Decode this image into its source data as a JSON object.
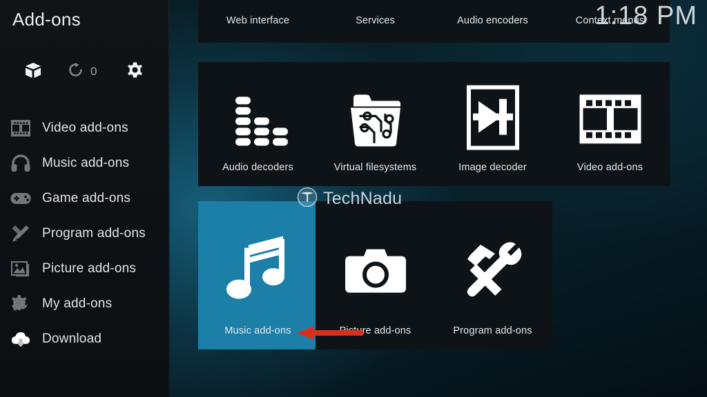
{
  "window": {
    "title": "Add-ons",
    "clock": "1:18 PM"
  },
  "header": {
    "install_icon": "package-box-icon",
    "update_icon": "refresh-icon",
    "update_count": "0",
    "settings_icon": "gear-icon"
  },
  "sidebar": {
    "items": [
      {
        "label": "Video add-ons",
        "icon": "film-strip-icon"
      },
      {
        "label": "Music add-ons",
        "icon": "headphones-icon"
      },
      {
        "label": "Game add-ons",
        "icon": "gamepad-icon"
      },
      {
        "label": "Program add-ons",
        "icon": "pencil-ruler-icon"
      },
      {
        "label": "Picture add-ons",
        "icon": "picture-frame-icon"
      },
      {
        "label": "My add-ons",
        "icon": "gear-wrench-icon"
      },
      {
        "label": "Download",
        "icon": "cloud-download-icon"
      }
    ]
  },
  "grid": {
    "row_top": [
      {
        "label": "Web interface",
        "icon": "web-interface-icon"
      },
      {
        "label": "Services",
        "icon": "services-icon"
      },
      {
        "label": "Audio encoders",
        "icon": "audio-encoders-icon"
      },
      {
        "label": "Context menus",
        "icon": "context-menus-icon"
      }
    ],
    "row_mid": [
      {
        "label": "Audio decoders",
        "icon": "equalizer-icon"
      },
      {
        "label": "Virtual filesystems",
        "icon": "circuit-folder-icon"
      },
      {
        "label": "Image decoder",
        "icon": "image-decoder-icon"
      },
      {
        "label": "Video add-ons",
        "icon": "film-strip-icon"
      }
    ],
    "row_bot": [
      {
        "label": "Music add-ons",
        "icon": "music-note-icon",
        "selected": true
      },
      {
        "label": "Picture add-ons",
        "icon": "camera-icon",
        "selected": false
      },
      {
        "label": "Program add-ons",
        "icon": "hammer-wrench-icon",
        "selected": false
      }
    ]
  },
  "watermark": {
    "text": "TechNadu",
    "logo_icon": "technadu-logo-icon"
  },
  "annotation": {
    "arrow_icon": "left-arrow-annotation",
    "arrow_color": "#d6301f",
    "points_to": "Music add-ons"
  },
  "colors": {
    "selected_tile": "#1b7fa8",
    "tile_background": "#0d1316",
    "sidebar_background": "#0d1114",
    "accent_red": "#d6301f",
    "text_primary": "#e4eaec"
  }
}
